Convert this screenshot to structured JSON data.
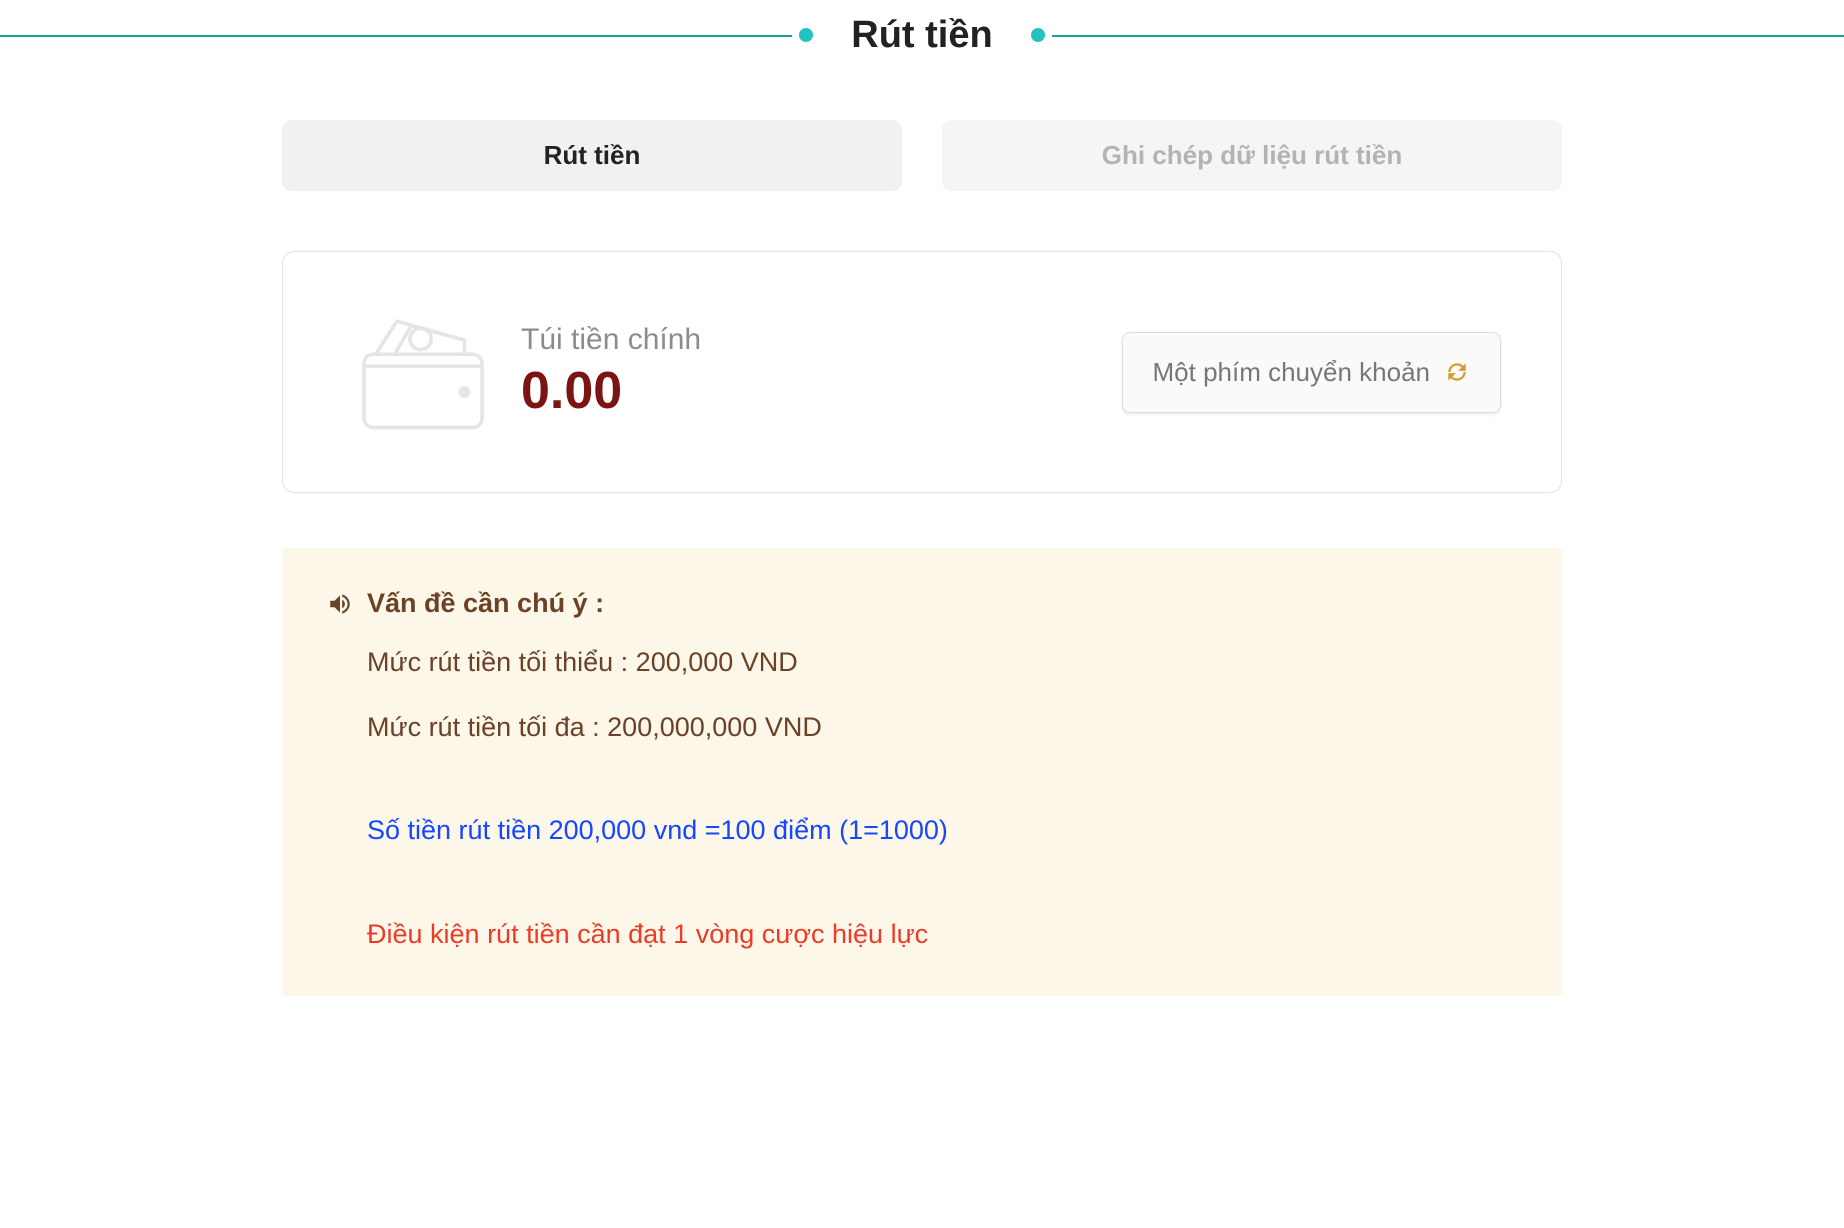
{
  "header": {
    "title": "Rút tiền"
  },
  "tabs": [
    {
      "label": "Rút tiền",
      "active": true
    },
    {
      "label": "Ghi chép dữ liệu rút tiền",
      "active": false
    }
  ],
  "wallet": {
    "label": "Túi tiền chính",
    "amount": "0.00",
    "transfer_button": "Một phím chuyển khoản"
  },
  "notice": {
    "heading": "Vấn đề cần chú ý :",
    "min_line": "Mức rút tiền tối thiểu : 200,000 VND",
    "max_line": "Mức rút tiền tối đa : 200,000,000 VND",
    "rate_line": "Số tiền rút tiền 200,000 vnd =100 điểm (1=1000)",
    "condition_line": "Điều kiện rút tiền cần đạt 1 vòng cược hiệu lực"
  },
  "colors": {
    "teal": "#16a19c",
    "amount": "#7c1414",
    "brown": "#6b4226",
    "blue": "#1447ff",
    "red": "#eb3c27",
    "refresh": "#d69a2d"
  }
}
